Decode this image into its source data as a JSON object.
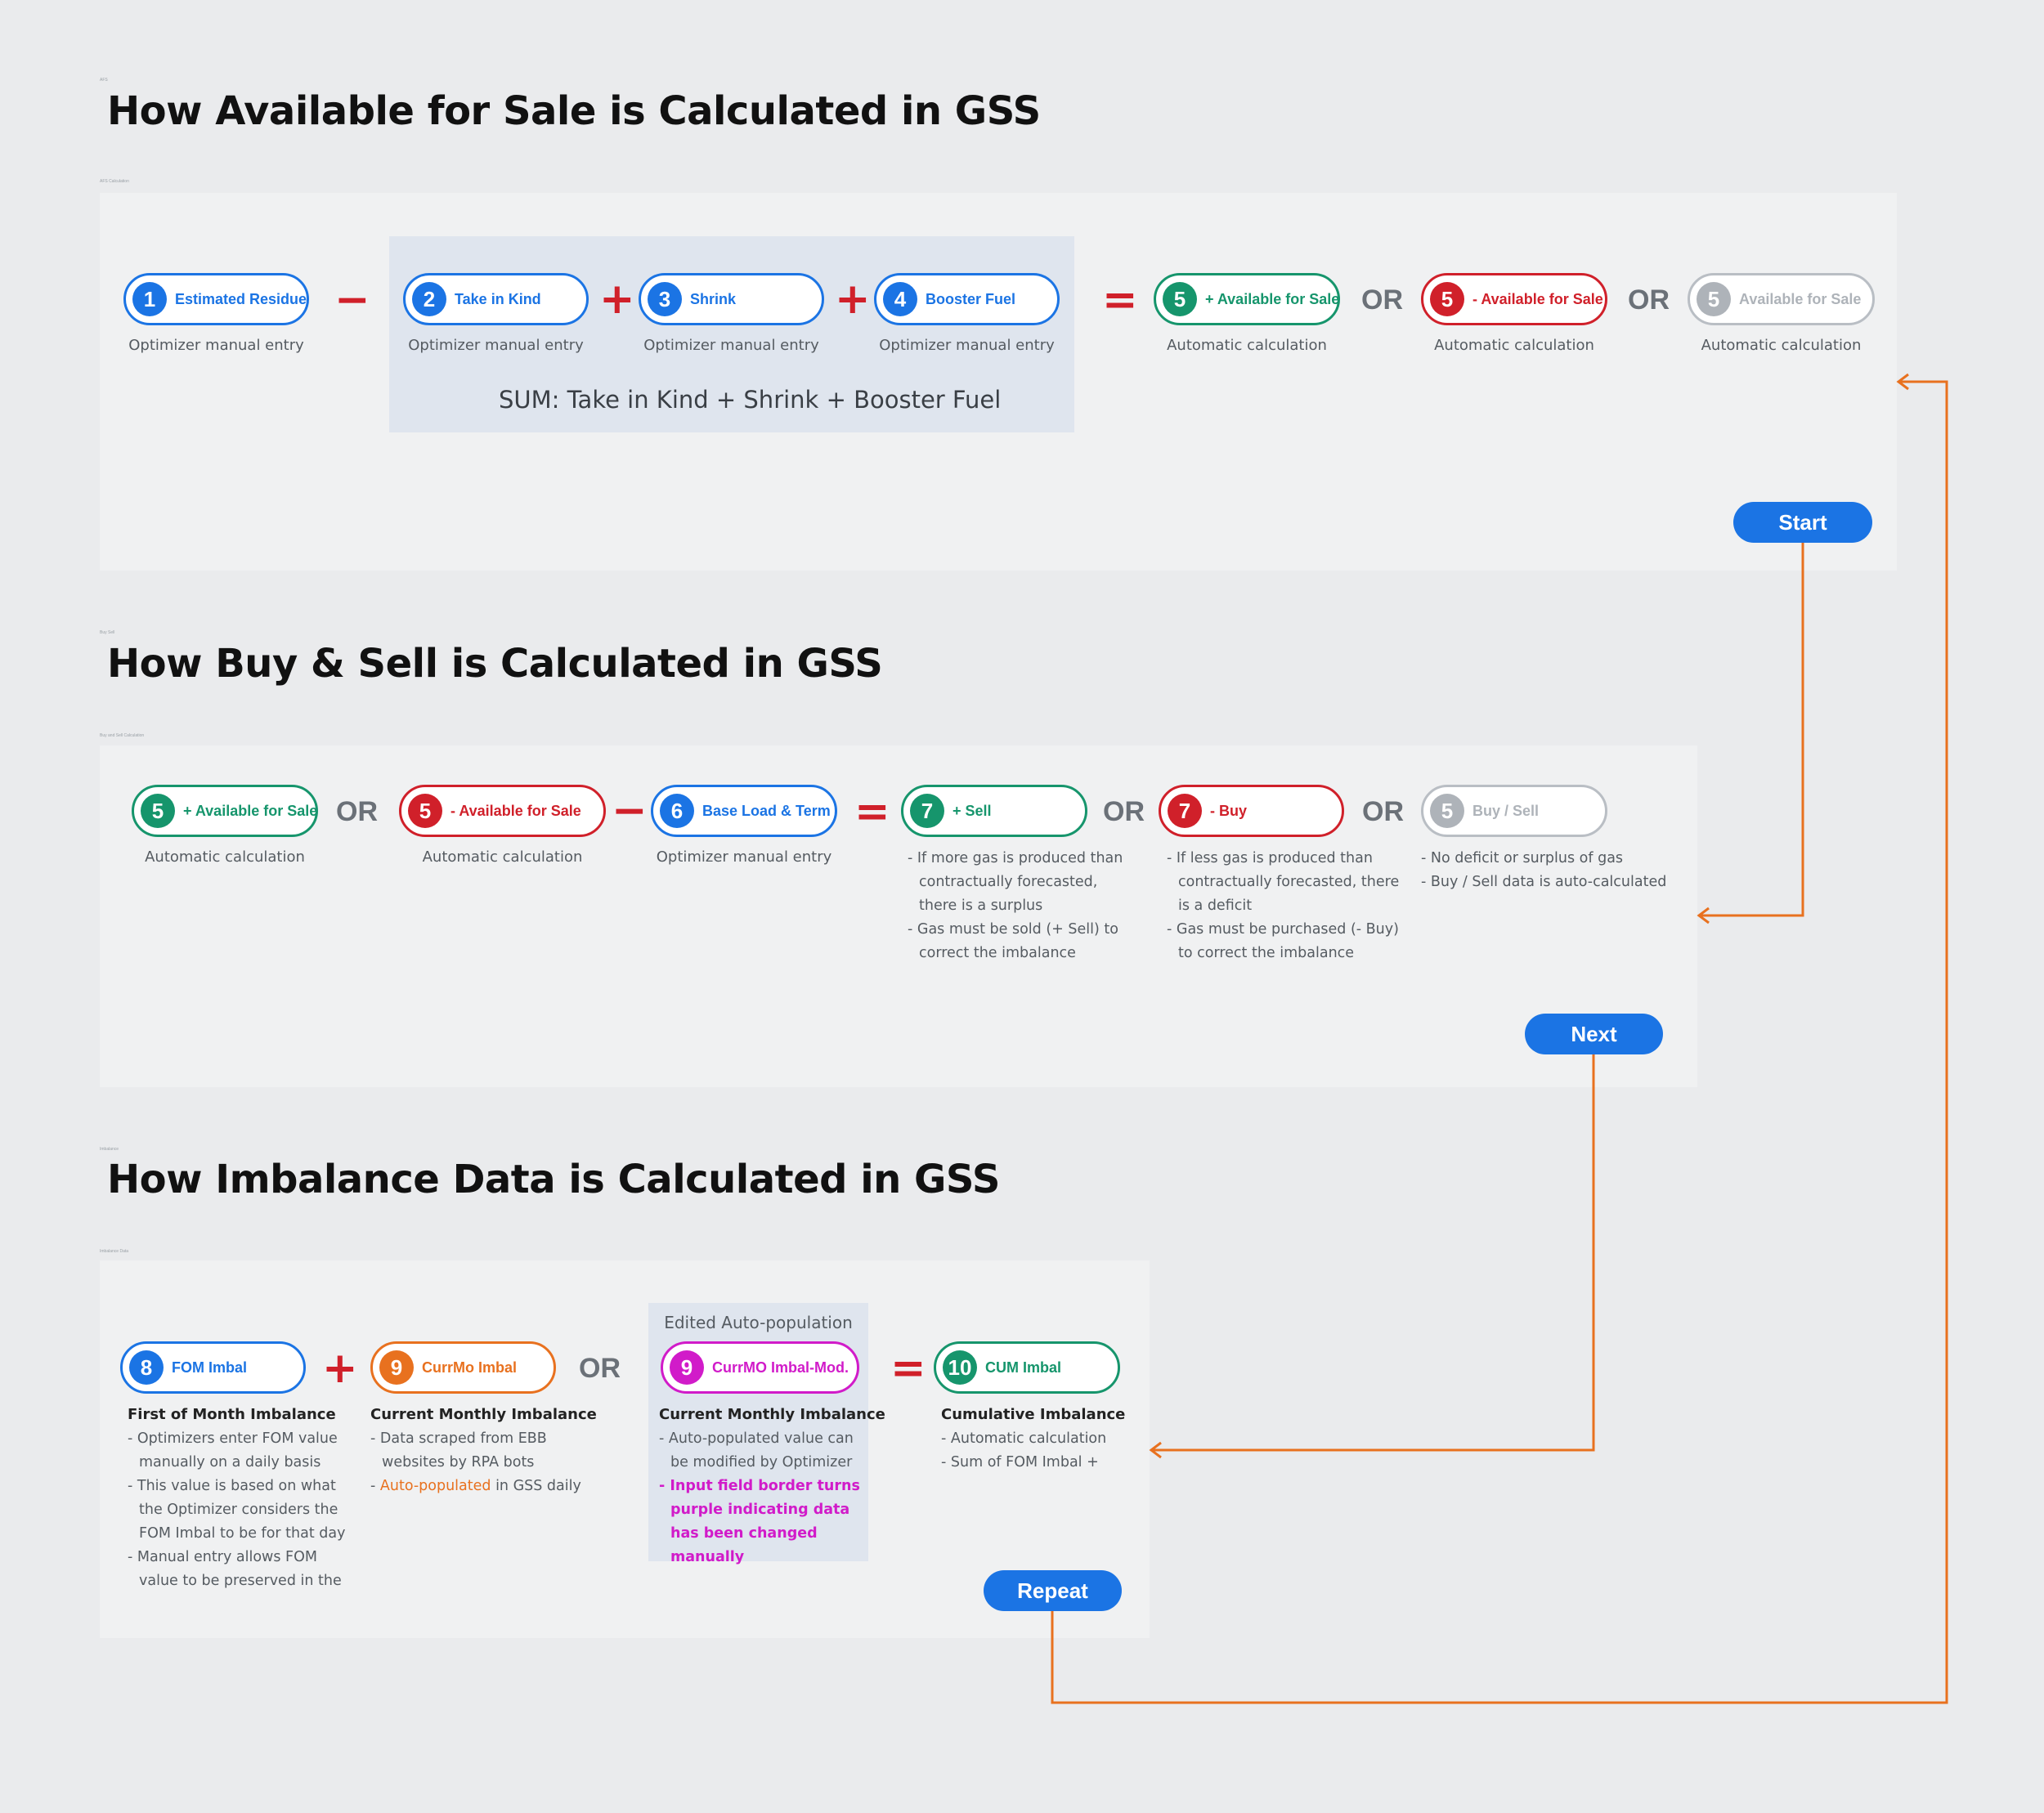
{
  "tiny_labels": {
    "afs_frame": "AFS",
    "afs_panel": "AFS Calculation",
    "buysell_frame": "Buy Sell",
    "buysell_panel": "Buy and Sell Calculation",
    "imbalance_frame": "Imbalance",
    "imbalance_panel": "Imbalance Data"
  },
  "afs": {
    "title": "How Available for Sale is Calculated in GSS",
    "items": [
      {
        "num": "1",
        "label": "Estimated Residue",
        "caption": "Optimizer manual entry"
      },
      {
        "num": "2",
        "label": "Take in Kind",
        "caption": "Optimizer manual entry"
      },
      {
        "num": "3",
        "label": "Shrink",
        "caption": "Optimizer manual entry"
      },
      {
        "num": "4",
        "label": "Booster Fuel",
        "caption": "Optimizer manual entry"
      },
      {
        "num": "5",
        "label": "+ Available for Sale",
        "caption": "Automatic calculation"
      },
      {
        "num": "5",
        "label": "- Available for Sale",
        "caption": "Automatic calculation"
      },
      {
        "num": "5",
        "label": "Available for Sale",
        "caption": "Automatic calculation"
      }
    ],
    "ops": {
      "minus": "−",
      "plus": "+",
      "equals": "=",
      "or": "OR"
    },
    "sum_text": "SUM:  Take in Kind + Shrink + Booster Fuel",
    "button": "Start"
  },
  "buysell": {
    "title": "How Buy & Sell is Calculated in GSS",
    "items": [
      {
        "num": "5",
        "label": "+ Available for Sale",
        "caption": "Automatic calculation"
      },
      {
        "num": "5",
        "label": "- Available for Sale",
        "caption": "Automatic calculation"
      },
      {
        "num": "6",
        "label": "Base Load & Term",
        "caption": "Optimizer manual entry"
      },
      {
        "num": "7",
        "label": "+ Sell"
      },
      {
        "num": "7",
        "label": "- Buy"
      },
      {
        "num": "5",
        "label": "Buy / Sell"
      }
    ],
    "sell_desc": [
      "If more gas is produced than contractually forecasted, there is a surplus",
      "Gas must be sold (+ Sell) to correct the imbalance"
    ],
    "buy_desc": [
      "If less gas is produced than contractually forecasted, there is a deficit",
      "Gas must be purchased (- Buy) to correct the imbalance"
    ],
    "neutral_desc": [
      "No deficit or surplus of gas",
      "Buy / Sell data is auto-calculated"
    ],
    "button": "Next"
  },
  "imbalance": {
    "title": "How Imbalance Data is Calculated in GSS",
    "edited_label": "Edited Auto-population",
    "items": [
      {
        "num": "8",
        "label": "FOM Imbal"
      },
      {
        "num": "9",
        "label": "CurrMo Imbal"
      },
      {
        "num": "9",
        "label": "CurrMO Imbal-Mod."
      },
      {
        "num": "10",
        "label": "CUM Imbal"
      }
    ],
    "fom": {
      "heading": "First of Month Imbalance",
      "lines": [
        "Optimizers enter FOM value manually on a daily basis",
        "This value is based on what the Optimizer considers the FOM Imbal to be for that day",
        "Manual entry allows FOM value to be preserved in the"
      ]
    },
    "currmo": {
      "heading": "Current Monthly Imbalance",
      "line1": "Data scraped from EBB websites by RPA bots",
      "line2_highlight": "Auto-populated",
      "line2_rest": " in GSS daily"
    },
    "currmo_mod": {
      "heading": "Current Monthly Imbalance",
      "line1": "Auto-populated value can be modified by Optimizer",
      "line2": "Input field border turns purple indicating data has been changed manually"
    },
    "cum": {
      "heading": "Cumulative Imbalance",
      "lines": [
        "Automatic calculation",
        "Sum of FOM Imbal +"
      ]
    },
    "button": "Repeat"
  },
  "colors": {
    "blue": "#1b74e4",
    "green": "#16956c",
    "red": "#d0202a",
    "grey": "#aeb3b9",
    "orange": "#e8711f",
    "purple": "#d11bc9",
    "connector": "#e8711f"
  }
}
